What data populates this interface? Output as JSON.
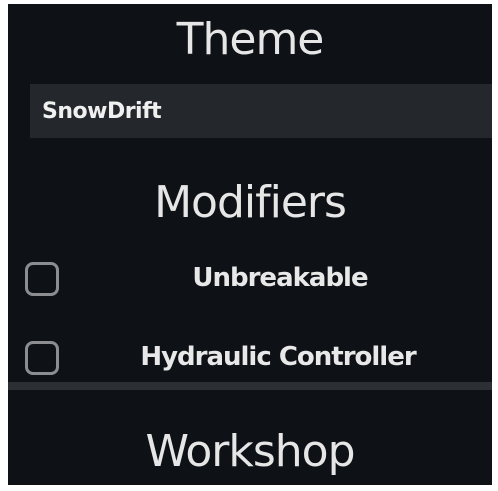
{
  "theme_section": {
    "title": "Theme",
    "selected_value": "SnowDrift"
  },
  "modifiers_section": {
    "title": "Modifiers",
    "items": [
      {
        "label": "Unbreakable",
        "checked": false
      },
      {
        "label": "Hydraulic Controller",
        "checked": false
      }
    ]
  },
  "workshop_section": {
    "title": "Workshop"
  },
  "colors": {
    "background": "#0e1116",
    "field_background": "#24272b",
    "text": "#e6e6e6",
    "checkbox_border": "#8b8d90"
  }
}
